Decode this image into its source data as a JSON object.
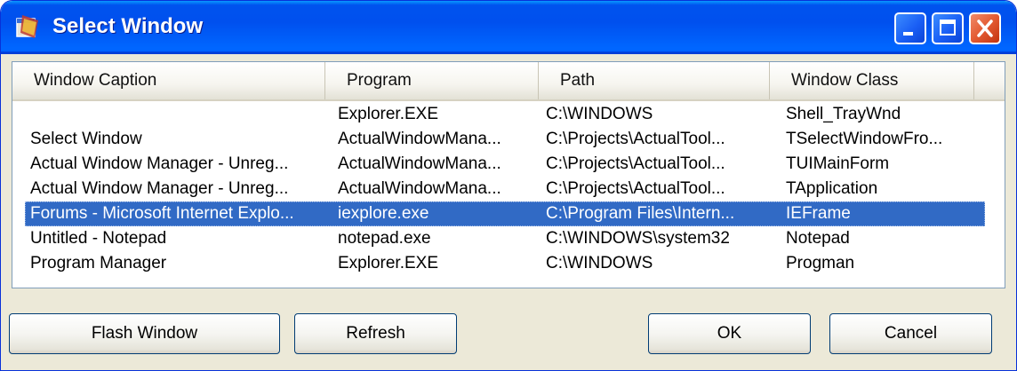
{
  "window": {
    "title": "Select Window",
    "icon": "app-window-icon",
    "controls": [
      "minimize-icon",
      "maximize-icon",
      "close-icon"
    ]
  },
  "list": {
    "columns": [
      "Window Caption",
      "Program",
      "Path",
      "Window Class"
    ],
    "rows": [
      [
        "",
        "Explorer.EXE",
        "C:\\WINDOWS",
        "Shell_TrayWnd"
      ],
      [
        "Select Window",
        "ActualWindowMana...",
        "C:\\Projects\\ActualTool...",
        "TSelectWindowFro..."
      ],
      [
        "Actual Window Manager - Unreg...",
        "ActualWindowMana...",
        "C:\\Projects\\ActualTool...",
        "TUIMainForm"
      ],
      [
        "Actual Window Manager - Unreg...",
        "ActualWindowMana...",
        "C:\\Projects\\ActualTool...",
        "TApplication"
      ],
      [
        "Forums - Microsoft Internet Explo...",
        "iexplore.exe",
        "C:\\Program Files\\Intern...",
        "IEFrame"
      ],
      [
        "Untitled - Notepad",
        "notepad.exe",
        "C:\\WINDOWS\\system32",
        "Notepad"
      ],
      [
        "Program Manager",
        "Explorer.EXE",
        "C:\\WINDOWS",
        "Progman"
      ]
    ],
    "selected_index": 4,
    "selection_color": "#316ac5"
  },
  "buttons": {
    "flash": "Flash Window",
    "refresh": "Refresh",
    "ok": "OK",
    "cancel": "Cancel"
  },
  "colors": {
    "titlebar": "#0053ee",
    "close_button": "#e35a32",
    "dialog_bg": "#ece9d8"
  }
}
